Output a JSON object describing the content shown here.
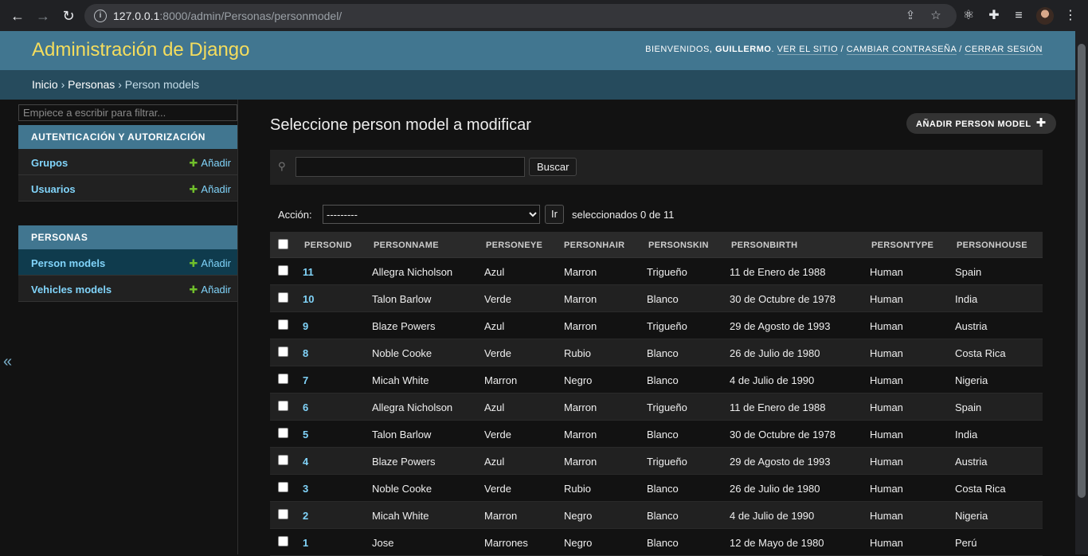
{
  "browser": {
    "url_host": "127.0.0.1",
    "url_path": ":8000/admin/Personas/personmodel/"
  },
  "header": {
    "branding": "Administración de Django",
    "welcome": "BIENVENIDOS,",
    "username": "GUILLERMO",
    "view_site": "VER EL SITIO",
    "change_password": "CAMBIAR CONTRASEÑA",
    "logout": "CERRAR SESIÓN",
    "sep": "/"
  },
  "breadcrumbs": {
    "home": "Inicio",
    "app": "Personas",
    "current": "Person models",
    "sep": "›"
  },
  "sidebar": {
    "filter_placeholder": "Empiece a escribir para filtrar...",
    "modules": [
      {
        "caption": "AUTENTICACIÓN Y AUTORIZACIÓN",
        "items": [
          {
            "label": "Grupos",
            "add": "Añadir"
          },
          {
            "label": "Usuarios",
            "add": "Añadir"
          }
        ]
      },
      {
        "caption": "PERSONAS",
        "items": [
          {
            "label": "Person models",
            "add": "Añadir"
          },
          {
            "label": "Vehicles models",
            "add": "Añadir"
          }
        ]
      }
    ],
    "collapse_glyph": "«"
  },
  "main": {
    "title": "Seleccione person model a modificar",
    "add_button": "AÑADIR PERSON MODEL",
    "search_button": "Buscar",
    "action_label": "Acción:",
    "action_selected": "---------",
    "go_button": "Ir",
    "counter": "seleccionados 0 de 11"
  },
  "table": {
    "columns": [
      "PERSONID",
      "PERSONNAME",
      "PERSONEYE",
      "PERSONHAIR",
      "PERSONSKIN",
      "PERSONBIRTH",
      "PERSONTYPE",
      "PERSONHOUSE"
    ],
    "rows": [
      [
        "11",
        "Allegra Nicholson",
        "Azul",
        "Marron",
        "Trigueño",
        "11 de Enero de 1988",
        "Human",
        "Spain"
      ],
      [
        "10",
        "Talon Barlow",
        "Verde",
        "Marron",
        "Blanco",
        "30 de Octubre de 1978",
        "Human",
        "India"
      ],
      [
        "9",
        "Blaze Powers",
        "Azul",
        "Marron",
        "Trigueño",
        "29 de Agosto de 1993",
        "Human",
        "Austria"
      ],
      [
        "8",
        "Noble Cooke",
        "Verde",
        "Rubio",
        "Blanco",
        "26 de Julio de 1980",
        "Human",
        "Costa Rica"
      ],
      [
        "7",
        "Micah White",
        "Marron",
        "Negro",
        "Blanco",
        "4 de Julio de 1990",
        "Human",
        "Nigeria"
      ],
      [
        "6",
        "Allegra Nicholson",
        "Azul",
        "Marron",
        "Trigueño",
        "11 de Enero de 1988",
        "Human",
        "Spain"
      ],
      [
        "5",
        "Talon Barlow",
        "Verde",
        "Marron",
        "Blanco",
        "30 de Octubre de 1978",
        "Human",
        "India"
      ],
      [
        "4",
        "Blaze Powers",
        "Azul",
        "Marron",
        "Trigueño",
        "29 de Agosto de 1993",
        "Human",
        "Austria"
      ],
      [
        "3",
        "Noble Cooke",
        "Verde",
        "Rubio",
        "Blanco",
        "26 de Julio de 1980",
        "Human",
        "Costa Rica"
      ],
      [
        "2",
        "Micah White",
        "Marron",
        "Negro",
        "Blanco",
        "4 de Julio de 1990",
        "Human",
        "Nigeria"
      ],
      [
        "1",
        "Jose",
        "Marrones",
        "Negro",
        "Blanco",
        "12 de Mayo de 1980",
        "Human",
        "Perú"
      ]
    ]
  },
  "colors": {
    "header_bg": "#417690",
    "breadcrumb_bg": "#264b5d",
    "branding": "#f5dd5d",
    "link": "#81d4fa",
    "add_plus": "#70bf2b"
  }
}
